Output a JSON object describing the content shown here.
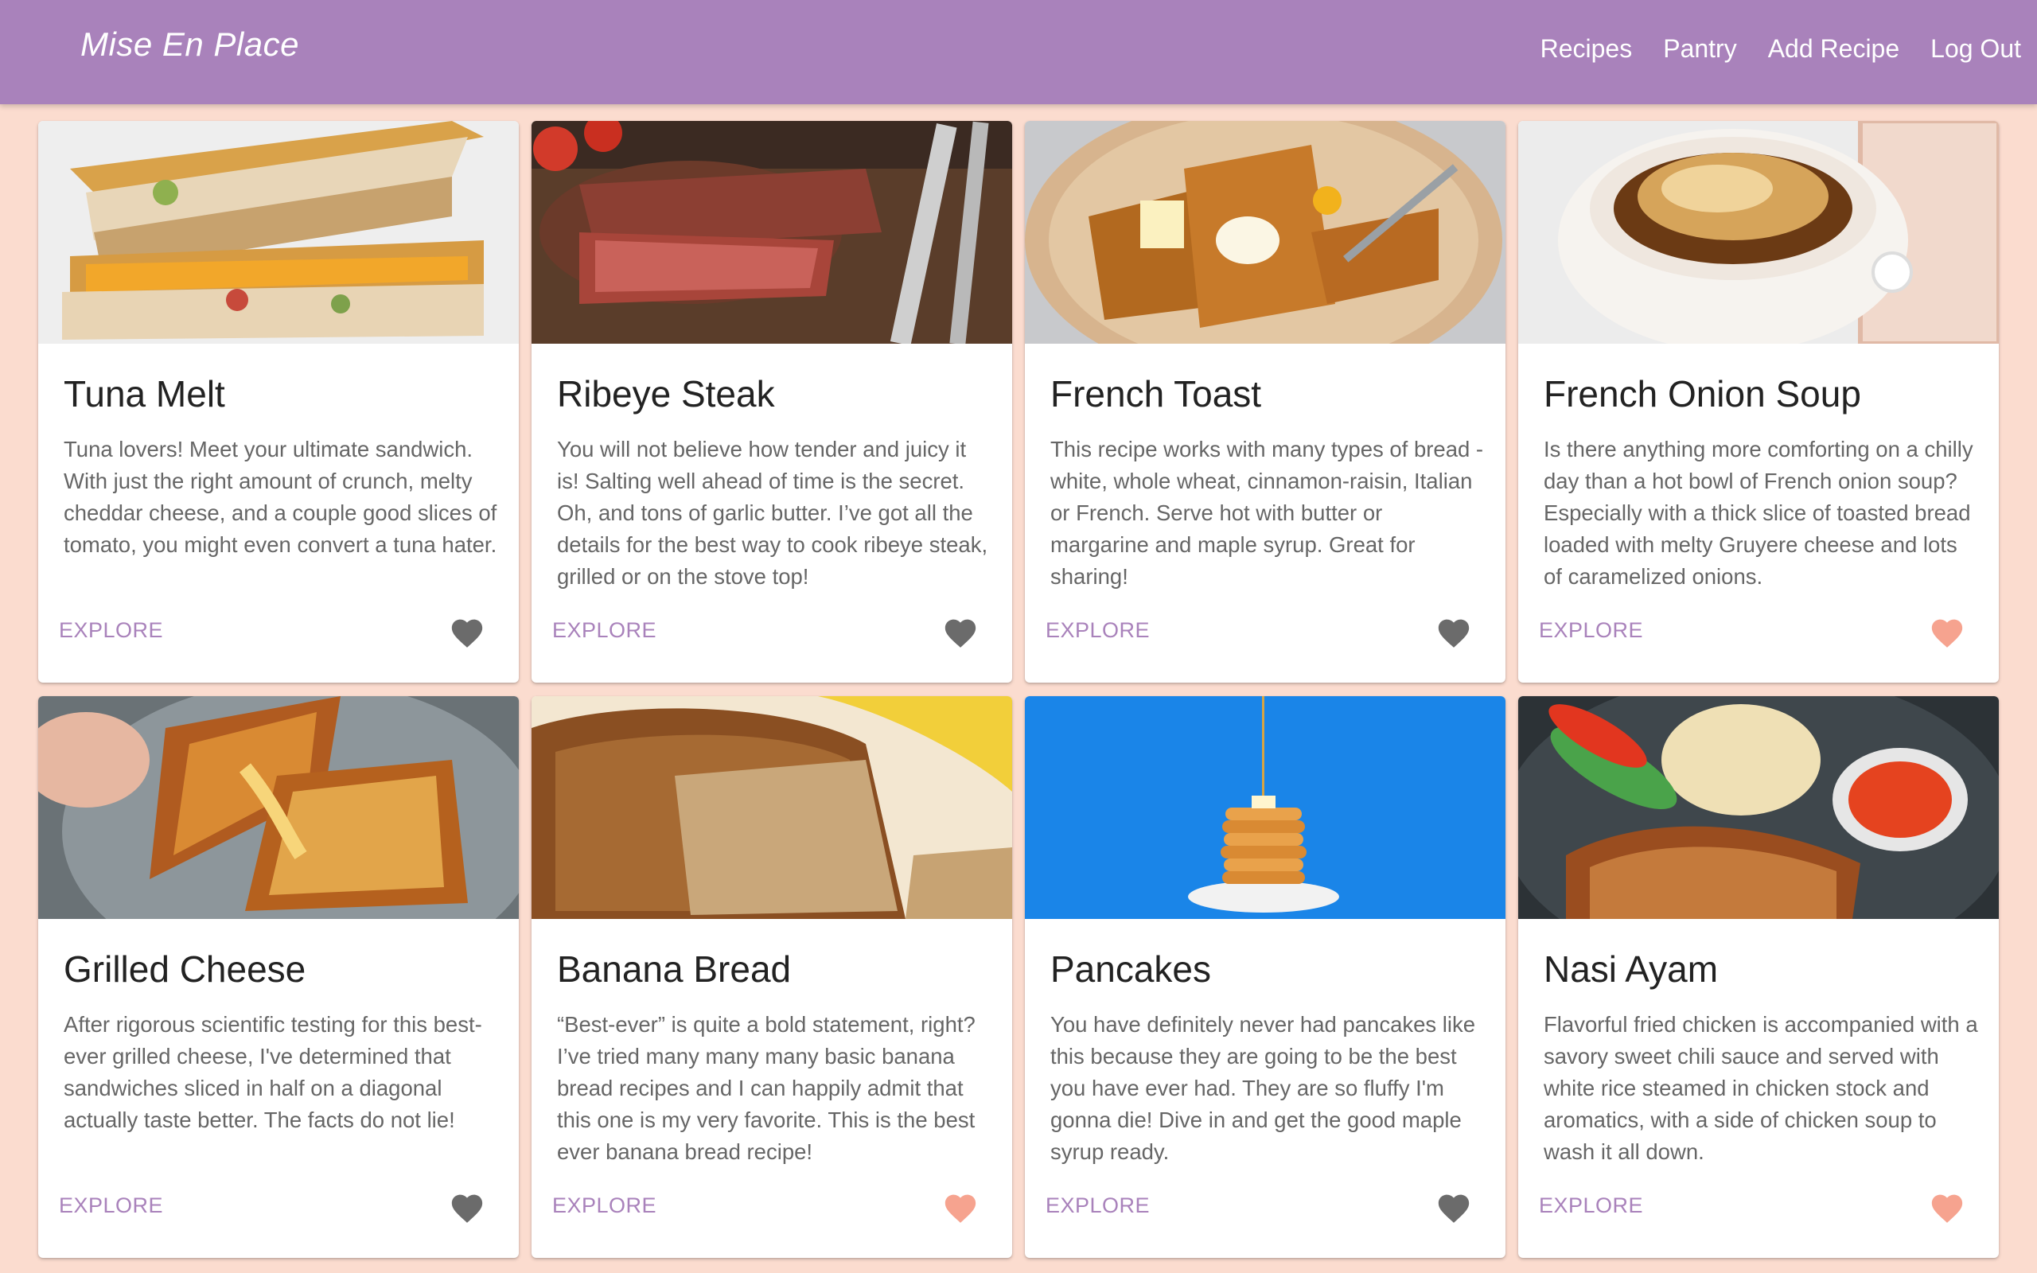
{
  "app": {
    "brand": "Mise En Place"
  },
  "nav": {
    "items": [
      "Recipes",
      "Pantry",
      "Add Recipe",
      "Log Out"
    ]
  },
  "colors": {
    "header": "#a982bb",
    "background": "#fbdccf",
    "explore": "#a982bb",
    "heart_active": "#f6a38f",
    "heart_inactive": "#6b6b6b"
  },
  "recipes": [
    {
      "title": "Tuna Melt",
      "description": "Tuna lovers! Meet your ultimate sandwich. With just the right amount of crunch, melty cheddar cheese, and a couple good slices of tomato, you might even convert a tuna hater.",
      "action": "EXPLORE",
      "favorite": false,
      "image": "tuna-melt-photo"
    },
    {
      "title": "Ribeye Steak",
      "description": "You will not believe how tender and juicy it is! Salting well ahead of time is the secret. Oh, and tons of garlic butter. I’ve got all the details for the best way to cook ribeye steak, grilled or on the stove top!",
      "action": "EXPLORE",
      "favorite": false,
      "image": "ribeye-steak-photo"
    },
    {
      "title": "French Toast",
      "description": "This recipe works with many types of bread - white, whole wheat, cinnamon-raisin, Italian or French. Serve hot with butter or margarine and maple syrup. Great for sharing!",
      "action": "EXPLORE",
      "favorite": false,
      "image": "french-toast-photo"
    },
    {
      "title": "French Onion Soup",
      "description": "Is there anything more comforting on a chilly day than a hot bowl of French onion soup? Especially with a thick slice of toasted bread loaded with melty Gruyere cheese and lots of caramelized onions.",
      "action": "EXPLORE",
      "favorite": true,
      "image": "french-onion-soup-photo"
    },
    {
      "title": "Grilled Cheese",
      "description": "After rigorous scientific testing for this best-ever grilled cheese, I've determined that sandwiches sliced in half on a diagonal actually taste better. The facts do not lie!",
      "action": "EXPLORE",
      "favorite": false,
      "image": "grilled-cheese-photo"
    },
    {
      "title": "Banana Bread",
      "description": "“Best-ever” is quite a bold statement, right? I’ve tried many many many basic banana bread recipes and I can happily admit that this one is my very favorite. This is the best ever banana bread recipe!",
      "action": "EXPLORE",
      "favorite": true,
      "image": "banana-bread-photo"
    },
    {
      "title": "Pancakes",
      "description": "You have definitely never had pancakes like this because they are going to be the best you have ever had. They are so fluffy I'm gonna die! Dive in and get the good maple syrup ready.",
      "action": "EXPLORE",
      "favorite": false,
      "image": "pancakes-photo"
    },
    {
      "title": "Nasi Ayam",
      "description": "Flavorful fried chicken is accompanied with a savory sweet chili sauce and served with white rice steamed in chicken stock and aromatics, with a side of chicken soup to wash it all down.",
      "action": "EXPLORE",
      "favorite": true,
      "image": "nasi-ayam-photo"
    }
  ]
}
